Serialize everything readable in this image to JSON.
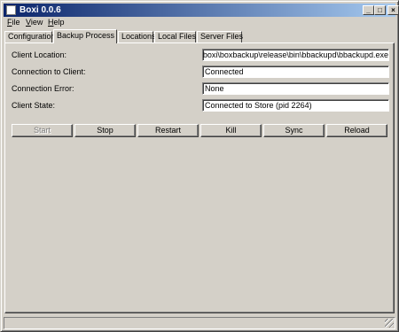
{
  "window": {
    "title": "Boxi 0.0.6"
  },
  "titlebar_buttons": {
    "minimize": "_",
    "maximize": "□",
    "close": "×"
  },
  "menu": [
    {
      "label": "File",
      "mnemonic": "F",
      "rest": "ile"
    },
    {
      "label": "View",
      "mnemonic": "V",
      "rest": "iew"
    },
    {
      "label": "Help",
      "mnemonic": "H",
      "rest": "elp"
    }
  ],
  "tabs": [
    {
      "label": "Configuration",
      "active": false
    },
    {
      "label": "Backup Process",
      "active": true
    },
    {
      "label": "Locations",
      "active": false
    },
    {
      "label": "Local Files",
      "active": false
    },
    {
      "label": "Server Files",
      "active": false
    }
  ],
  "fields": {
    "client_location": {
      "label": "Client Location:",
      "value": "on\\boxi\\boxbackup\\release\\bin\\bbackupd\\bbackupd.exe"
    },
    "connection_to_client": {
      "label": "Connection to Client:",
      "value": "Connected"
    },
    "connection_error": {
      "label": "Connection Error:",
      "value": "None"
    },
    "client_state": {
      "label": "Client State:",
      "value": "Connected to Store (pid 2264)"
    }
  },
  "buttons": [
    {
      "label": "Start",
      "enabled": false
    },
    {
      "label": "Stop",
      "enabled": true
    },
    {
      "label": "Restart",
      "enabled": true
    },
    {
      "label": "Kill",
      "enabled": true
    },
    {
      "label": "Sync",
      "enabled": true
    },
    {
      "label": "Reload",
      "enabled": true
    }
  ]
}
